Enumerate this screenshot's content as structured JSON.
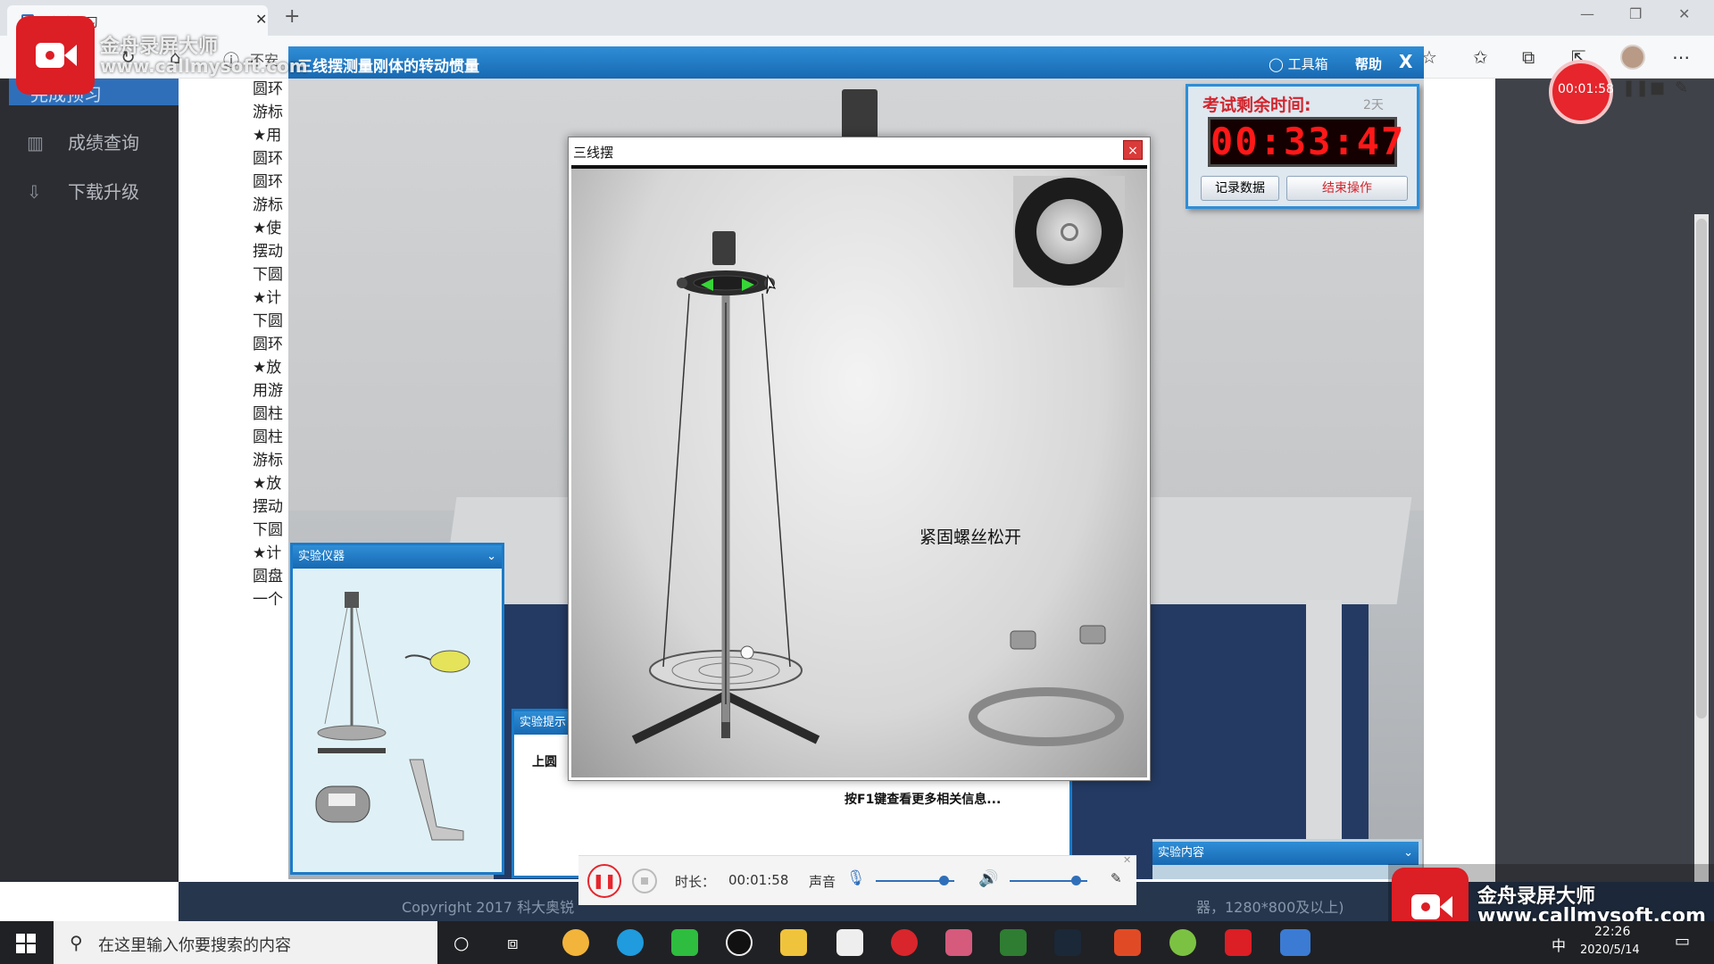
{
  "browser": {
    "tab_title": "完成预习",
    "url_prefix": "不安",
    "new_tab": "+",
    "tab_close": "✕"
  },
  "sidebar": {
    "items": [
      {
        "label": "完成预习",
        "icon": "doc-icon"
      },
      {
        "label": "成绩查询",
        "icon": "bar-chart-icon"
      },
      {
        "label": "下载升级",
        "icon": "download-icon"
      }
    ]
  },
  "content_lines": [
    "圆环",
    "游标",
    "★用",
    "圆环",
    "圆环",
    "游标",
    "★使",
    "摆动",
    "下圆",
    "★计",
    "下圆",
    "圆环",
    "★放",
    "用游",
    "圆柱",
    "圆柱",
    "游标",
    "★放",
    "摆动",
    "下圆",
    "★计",
    "圆盘",
    "一个"
  ],
  "footer": {
    "copyright": "Copyright 2017 科大奥锐",
    "right_text": "器，1280*800及以上)"
  },
  "sim": {
    "title": "三线摆测量刚体的转动惯量",
    "toolbox": "工具箱",
    "help": "帮助",
    "close": "X",
    "timer": {
      "label": "考试剩余时间:",
      "days": "2天",
      "value": "00:33:47",
      "record_button": "记录数据",
      "end_button": "结束操作"
    },
    "dialog": {
      "title": "三线摆",
      "close": "×",
      "note": "紧固螺丝松开"
    },
    "instruments_title": "实验仪器",
    "tips_title": "实验提示",
    "tips_line1": "上圆",
    "tips_line2": "按F1键查看更多相关信息...",
    "content_title": "实验内容"
  },
  "recorder": {
    "brand": "金舟录屏大师",
    "site": "www.callmysoft.com",
    "badge_time": "00:01:58",
    "duration_label": "时长：",
    "duration_value": "00:01:58",
    "sound_label": "声音",
    "mic_level": 0.86,
    "speaker_level": 0.85
  },
  "taskbar": {
    "search_placeholder": "在这里输入你要搜索的内容",
    "ime": "中",
    "time": "22:26",
    "date": "2020/5/14"
  },
  "colors": {
    "sim_blue": "#1769b3",
    "timer_red": "#ff1818",
    "recorder_red": "#dc1e25",
    "sidebar_bg": "#2b2d33"
  }
}
